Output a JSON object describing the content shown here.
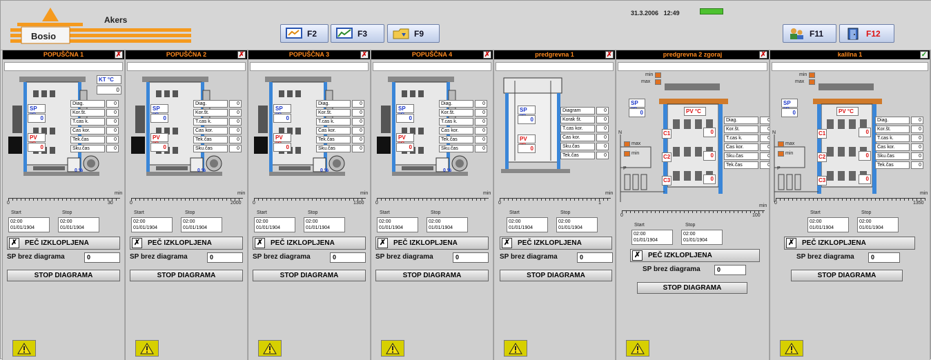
{
  "header": {
    "logo_text": "Bosio",
    "app_name": "Akers",
    "date": "31.3.2006",
    "time": "12:49",
    "fkeys": [
      {
        "label": "F2",
        "icon": "monitor-icon"
      },
      {
        "label": "F3",
        "icon": "chart-icon"
      },
      {
        "label": "F9",
        "icon": "folder-icon"
      },
      {
        "label": "F11",
        "icon": "users-icon"
      },
      {
        "label": "F12",
        "icon": "exit-door-icon"
      }
    ],
    "status_color": "#4ec230"
  },
  "common": {
    "off_label": "PEČ IZKLOPLJENA",
    "sp_no_diag_label": "SP brez diagrama",
    "stop_label": "STOP DIAGRAMA",
    "start_label": "Start",
    "stop_time_label": "Stop",
    "time_value": "02:00",
    "date_value": "01/01/1904",
    "sp_label": "SP",
    "pv_label": "PV",
    "unit": "°C",
    "min_unit": "min",
    "kt_label": "KT °C",
    "kt_value": "0",
    "zero": "0",
    "percent": "0 %",
    "min_label": "min",
    "max_label": "max",
    "c_labels": [
      "C1",
      "C2",
      "C3"
    ],
    "n_label": "N",
    "p_label": "P",
    "axis_zero": "0"
  },
  "panels": [
    {
      "title": "POPUŠČNA 1",
      "rows": [
        "Diag.",
        "Kor.št.",
        "T.cas k.",
        "Čas kor.",
        "Tek.čas",
        "Sku.čas"
      ],
      "axis_end": "30"
    },
    {
      "title": "POPUŠČNA 2",
      "rows": [
        "Diag.",
        "Kor.št.",
        "T.cas k.",
        "Čas kor.",
        "Tek.čas",
        "Sku.čas"
      ],
      "axis_end": "2000"
    },
    {
      "title": "POPUŠČNA 3",
      "rows": [
        "Diag.",
        "Kor.št.",
        "T.cas k.",
        "Čas kor.",
        "Tek.čas",
        "Sku.čas"
      ],
      "axis_end": "1300"
    },
    {
      "title": "POPUŠČNA 4",
      "rows": [
        "Diag.",
        "Kor.št.",
        "T.cas k.",
        "Čas kor.",
        "Tek.čas",
        "Sku.čas"
      ],
      "axis_end": ""
    },
    {
      "title": "predgrevna 1",
      "rows": [
        "Diagram",
        "Korak št.",
        "T.cas kor.",
        "Čas kor.",
        "Sku.čas",
        "Tek.čas"
      ],
      "axis_end": "1"
    },
    {
      "title": "predgrevna 2 zgoraj",
      "rows": [
        "Diag.",
        "Kor.št.",
        "T.cas k.",
        "Čas kor.",
        "Sku.čas",
        "Tek.čas"
      ],
      "axis_end": "100"
    },
    {
      "title": "kalilna 1",
      "rows": [
        "Diag.",
        "Kor.št.",
        "T.cas k.",
        "Čas kor.",
        "Sku.čas",
        "Tek.čas"
      ],
      "axis_end": "1350"
    }
  ]
}
